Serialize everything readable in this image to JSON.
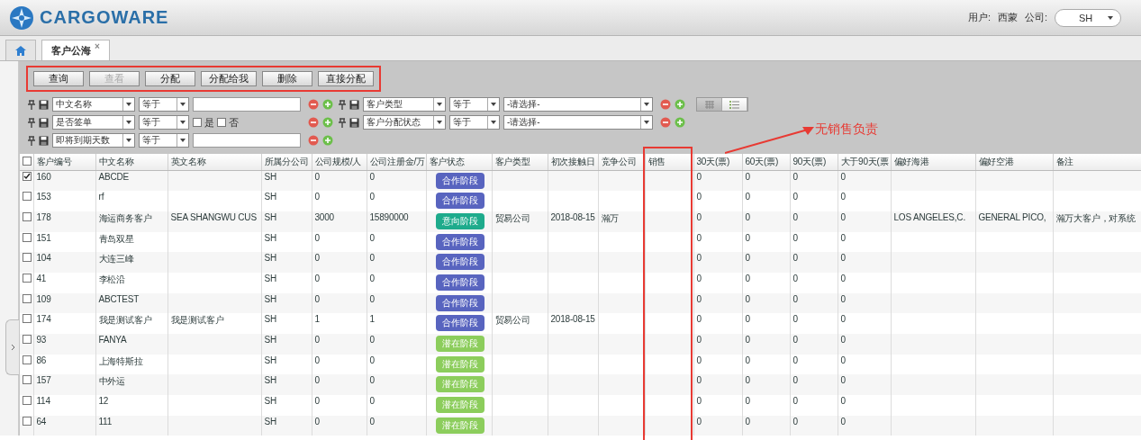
{
  "header": {
    "logo": "CARGOWARE",
    "user_label": "用户:",
    "user": "西蒙",
    "company_label": "公司:",
    "company": "SH"
  },
  "tabs": [
    {
      "kind": "home",
      "selected": false
    },
    {
      "kind": "page",
      "label": "客户公海",
      "close": "×",
      "selected": true
    }
  ],
  "toolbar": [
    {
      "label": "查询",
      "disabled": false
    },
    {
      "label": "查看",
      "disabled": true
    },
    {
      "label": "分配",
      "disabled": false
    },
    {
      "label": "分配给我",
      "disabled": false
    },
    {
      "label": "删除",
      "disabled": false
    },
    {
      "label": "直接分配",
      "disabled": false
    }
  ],
  "filters": [
    [
      {
        "field": "中文名称",
        "operator": "等于",
        "value": {
          "kind": "input"
        }
      },
      {
        "field": "客户类型",
        "operator": "等于",
        "value": {
          "kind": "select",
          "text": "-请选择-"
        }
      }
    ],
    [
      {
        "field": "是否签单",
        "operator": "等于",
        "value": {
          "kind": "checks",
          "options": [
            {
              "label": "是",
              "checked": false
            },
            {
              "label": "否",
              "checked": false
            }
          ]
        }
      },
      {
        "field": "客户分配状态",
        "operator": "等于",
        "value": {
          "kind": "select",
          "text": "-请选择-"
        }
      }
    ],
    [
      {
        "field": "即将到期天数",
        "operator": "等于",
        "value": {
          "kind": "input"
        }
      }
    ]
  ],
  "view_toggle": [
    {
      "kind": "grid",
      "selected": true
    },
    {
      "kind": "list",
      "selected": false
    }
  ],
  "table": {
    "header_checked": false,
    "columns": [
      "客户编号",
      "中文名称",
      "英文名称",
      "所属分公司",
      "公司规模/人",
      "公司注册金/万",
      "客户状态",
      "客户类型",
      "初次接触日",
      "竞争公司",
      "销售",
      "30天(票)",
      "60天(票)",
      "90天(票)",
      "大于90天(票",
      "偏好海港",
      "偏好空港",
      "备注"
    ],
    "rows": [
      {
        "checked": true,
        "cells": [
          "160",
          "ABCDE",
          null,
          "SH",
          "0",
          "0",
          {
            "label": "合作阶段",
            "color": "#5864bf"
          },
          null,
          null,
          null,
          null,
          "0",
          "0",
          "0",
          "0",
          null,
          null,
          null
        ]
      },
      {
        "checked": false,
        "cells": [
          "153",
          "rf",
          null,
          "SH",
          "0",
          "0",
          {
            "label": "合作阶段",
            "color": "#5864bf"
          },
          null,
          null,
          null,
          null,
          "0",
          "0",
          "0",
          "0",
          null,
          null,
          null
        ]
      },
      {
        "checked": false,
        "cells": [
          "178",
          "海运商务客户",
          "SEA SHANGWU CUS",
          "SH",
          "3000",
          "15890000",
          {
            "label": "意向阶段",
            "color": "#1eab8c"
          },
          "贸易公司",
          "2018-08-15",
          "瀚万",
          null,
          "0",
          "0",
          "0",
          "0",
          "LOS ANGELES,C.",
          "GENERAL PICO,",
          "瀚万大客户，对系统"
        ]
      },
      {
        "checked": false,
        "cells": [
          "151",
          "青岛双星",
          null,
          "SH",
          "0",
          "0",
          {
            "label": "合作阶段",
            "color": "#5864bf"
          },
          null,
          null,
          null,
          null,
          "0",
          "0",
          "0",
          "0",
          null,
          null,
          null
        ]
      },
      {
        "checked": false,
        "cells": [
          "104",
          "大连三峰",
          null,
          "SH",
          "0",
          "0",
          {
            "label": "合作阶段",
            "color": "#5864bf"
          },
          null,
          null,
          null,
          null,
          "0",
          "0",
          "0",
          "0",
          null,
          null,
          null
        ]
      },
      {
        "checked": false,
        "cells": [
          "41",
          "李松沿",
          null,
          "SH",
          "0",
          "0",
          {
            "label": "合作阶段",
            "color": "#5864bf"
          },
          null,
          null,
          null,
          null,
          "0",
          "0",
          "0",
          "0",
          null,
          null,
          null
        ]
      },
      {
        "checked": false,
        "cells": [
          "109",
          "ABCTEST",
          null,
          "SH",
          "0",
          "0",
          {
            "label": "合作阶段",
            "color": "#5864bf"
          },
          null,
          null,
          null,
          null,
          "0",
          "0",
          "0",
          "0",
          null,
          null,
          null
        ]
      },
      {
        "checked": false,
        "cells": [
          "174",
          "我是测试客户",
          "我是测试客户",
          "SH",
          "1",
          "1",
          {
            "label": "合作阶段",
            "color": "#5864bf"
          },
          "贸易公司",
          "2018-08-15",
          null,
          null,
          "0",
          "0",
          "0",
          "0",
          null,
          null,
          null
        ]
      },
      {
        "checked": false,
        "cells": [
          "93",
          "FANYA",
          null,
          "SH",
          "0",
          "0",
          {
            "label": "潜在阶段",
            "color": "#8ccd5c"
          },
          null,
          null,
          null,
          null,
          "0",
          "0",
          "0",
          "0",
          null,
          null,
          null
        ]
      },
      {
        "checked": false,
        "cells": [
          "86",
          "上海特斯拉",
          null,
          "SH",
          "0",
          "0",
          {
            "label": "潜在阶段",
            "color": "#8ccd5c"
          },
          null,
          null,
          null,
          null,
          "0",
          "0",
          "0",
          "0",
          null,
          null,
          null
        ]
      },
      {
        "checked": false,
        "cells": [
          "157",
          "中外运",
          null,
          "SH",
          "0",
          "0",
          {
            "label": "潜在阶段",
            "color": "#8ccd5c"
          },
          null,
          null,
          null,
          null,
          "0",
          "0",
          "0",
          "0",
          null,
          null,
          null
        ]
      },
      {
        "checked": false,
        "cells": [
          "114",
          "12",
          null,
          "SH",
          "0",
          "0",
          {
            "label": "潜在阶段",
            "color": "#8ccd5c"
          },
          null,
          null,
          null,
          null,
          "0",
          "0",
          "0",
          "0",
          null,
          null,
          null
        ]
      },
      {
        "checked": false,
        "cells": [
          "64",
          "111",
          null,
          "SH",
          "0",
          "0",
          {
            "label": "潜在阶段",
            "color": "#8ccd5c"
          },
          null,
          null,
          null,
          null,
          "0",
          "0",
          "0",
          "0",
          null,
          null,
          null
        ]
      }
    ]
  },
  "annotation": {
    "text": "无销售负责"
  }
}
